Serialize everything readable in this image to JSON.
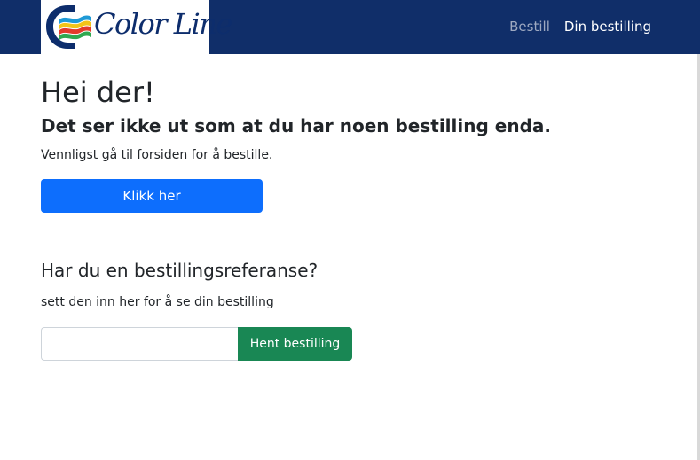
{
  "header": {
    "logo": {
      "text": "Color Line",
      "icon": "color-line-wave-logo",
      "colors": [
        "#0d2d6c",
        "#1f9ad6",
        "#f3c418",
        "#e33b2b",
        "#2fa84f"
      ]
    },
    "nav": [
      {
        "label": "Bestill",
        "active": false
      },
      {
        "label": "Din bestilling",
        "active": true
      }
    ]
  },
  "main": {
    "heading": "Hei der!",
    "subtitle": "Det ser ikke ut som at du har noen bestilling enda.",
    "description": "Vennligst gå til forsiden for å bestille.",
    "button_label": "Klikk her",
    "reference": {
      "title": "Har du en bestillingsreferanse?",
      "description": "sett den inn her for å se din bestilling",
      "input_value": "",
      "input_placeholder": "",
      "button_label": "Hent bestilling"
    }
  },
  "colors": {
    "navbar_bg": "#102e69",
    "primary": "#0d6efd",
    "success": "#198754",
    "nav_inactive": "#9ea9c1",
    "nav_active": "#ffffff"
  }
}
